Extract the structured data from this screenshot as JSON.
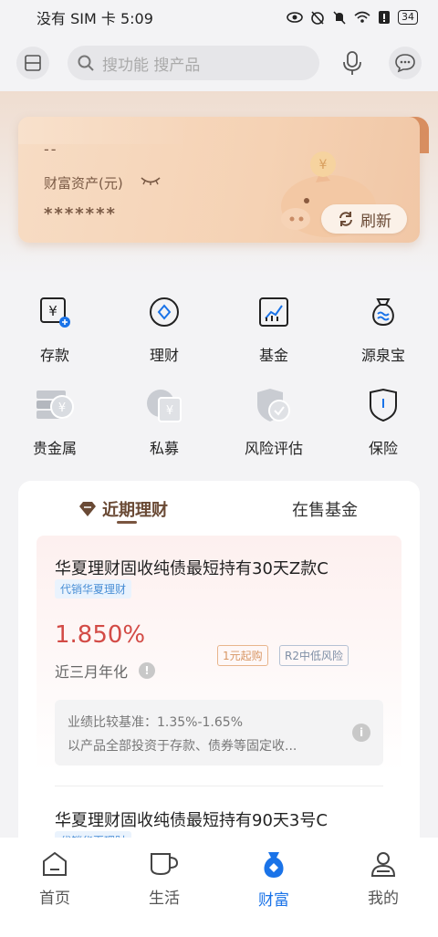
{
  "status": {
    "carrier": "没有 SIM 卡",
    "time": "5:09",
    "battery": "34"
  },
  "search": {
    "placeholder": "搜功能 搜产品"
  },
  "card": {
    "dashes": "--",
    "label": "财富资产(元)",
    "amount": "*******",
    "refresh": "刷新"
  },
  "grid": [
    {
      "label": "存款",
      "icon": "deposit-icon"
    },
    {
      "label": "理财",
      "icon": "wealth-management-icon"
    },
    {
      "label": "基金",
      "icon": "fund-chart-icon"
    },
    {
      "label": "源泉宝",
      "icon": "money-bag-icon"
    },
    {
      "label": "贵金属",
      "icon": "gold-bar-icon"
    },
    {
      "label": "私募",
      "icon": "private-equity-icon"
    },
    {
      "label": "风险评估",
      "icon": "shield-check-icon"
    },
    {
      "label": "保险",
      "icon": "insurance-shield-icon"
    }
  ],
  "tabs": {
    "active": "近期理财",
    "other": "在售基金"
  },
  "product": {
    "title": "华夏理财固收纯债最短持有30天Z款C",
    "tag": "代销华夏理财",
    "rate": "1.850%",
    "rate_label": "近三月年化",
    "badge_min": "1元起购",
    "badge_risk": "R2中低风险",
    "bench_line1": "业绩比较基准：1.35%-1.65%",
    "bench_line2": "以产品全部投资于存款、债券等固定收..."
  },
  "product2": {
    "title": "华夏理财固收纯债最短持有90天3号C",
    "tag": "代销华夏理财"
  },
  "nav": [
    {
      "label": "首页",
      "icon": "home-icon"
    },
    {
      "label": "生活",
      "icon": "cup-icon"
    },
    {
      "label": "财富",
      "icon": "wealth-bag-icon"
    },
    {
      "label": "我的",
      "icon": "person-icon"
    }
  ],
  "colors": {
    "accent": "#1a73e8",
    "rate": "#d34b46",
    "brown": "#6a4a35"
  }
}
